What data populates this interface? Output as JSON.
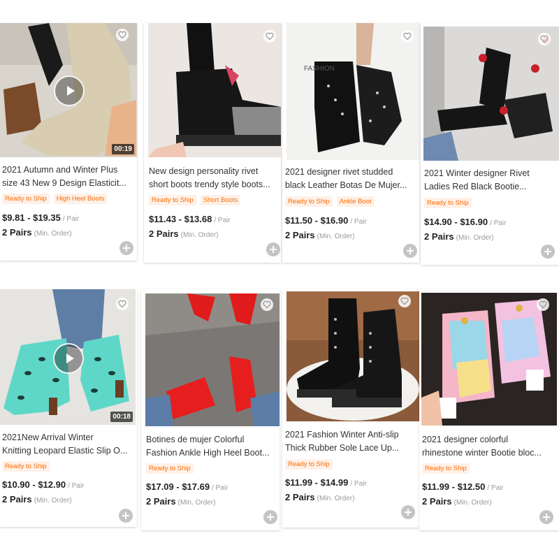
{
  "products": [
    {
      "title": "2021 Autumn and Winter Plus size 43 New 9 Design Elasticity...",
      "line1": "2021 Autumn and Winter Plus",
      "line2": "size 43 New 9 Design Elasticit...",
      "tags": [
        "Ready to Ship",
        "High Heel Boots"
      ],
      "price": "$9.81 - $19.35",
      "price_unit": "/ Pair",
      "moq": "2 Pairs",
      "moq_note": "(Min. Order)",
      "has_video": true,
      "duration": "00:19"
    },
    {
      "line1": "New design personality rivet",
      "line2": "short boots trendy style boots...",
      "tags": [
        "Ready to Ship",
        "Short Boots"
      ],
      "price": "$11.43 - $13.68",
      "price_unit": "/ Pair",
      "moq": "2 Pairs",
      "moq_note": "(Min. Order)",
      "has_video": false,
      "duration": ""
    },
    {
      "line1": "2021 designer rivet studded",
      "line2": "black Leather Botas De Mujer...",
      "tags": [
        "Ready to Ship",
        "Ankle Boot"
      ],
      "price": "$11.50 - $16.90",
      "price_unit": "/ Pair",
      "moq": "2 Pairs",
      "moq_note": "(Min. Order)",
      "has_video": false,
      "duration": ""
    },
    {
      "line1": "2021 Winter designer Rivet",
      "line2": "Ladies Red Black Bootie...",
      "tags": [
        "Ready to Ship"
      ],
      "price": "$14.90 - $16.90",
      "price_unit": "/ Pair",
      "moq": "2 Pairs",
      "moq_note": "(Min. Order)",
      "has_video": false,
      "duration": ""
    },
    {
      "line1": "2021New Arrival Winter",
      "line2": "Knitting Leopard Elastic Slip O...",
      "tags": [
        "Ready to Ship"
      ],
      "price": "$10.90 - $12.90",
      "price_unit": "/ Pair",
      "moq": "2 Pairs",
      "moq_note": "(Min. Order)",
      "has_video": true,
      "duration": "00:18"
    },
    {
      "line1": "Botines de mujer Colorful",
      "line2": "Fashion Ankle High Heel Boot...",
      "tags": [
        "Ready to Ship"
      ],
      "price": "$17.09 - $17.69",
      "price_unit": "/ Pair",
      "moq": "2 Pairs",
      "moq_note": "(Min. Order)",
      "has_video": false,
      "duration": ""
    },
    {
      "line1": "2021 Fashion Winter Anti-slip",
      "line2": "Thick Rubber Sole Lace Up...",
      "tags": [
        "Ready to Ship"
      ],
      "price": "$11.99 - $14.99",
      "price_unit": "/ Pair",
      "moq": "2 Pairs",
      "moq_note": "(Min. Order)",
      "has_video": false,
      "duration": ""
    },
    {
      "line1": "2021 designer colorful",
      "line2": "rhinestone winter Bootie bloc...",
      "tags": [
        "Ready to Ship"
      ],
      "price": "$11.99 - $12.50",
      "price_unit": "/ Pair",
      "moq": "2 Pairs",
      "moq_note": "(Min. Order)",
      "has_video": false,
      "duration": ""
    }
  ],
  "image_text": {
    "fashion_sign": "FASHION"
  },
  "colors": {
    "accent": "#ff6a00",
    "tag_bg": "#fff1e8",
    "add_button": "#c4c4c4"
  }
}
